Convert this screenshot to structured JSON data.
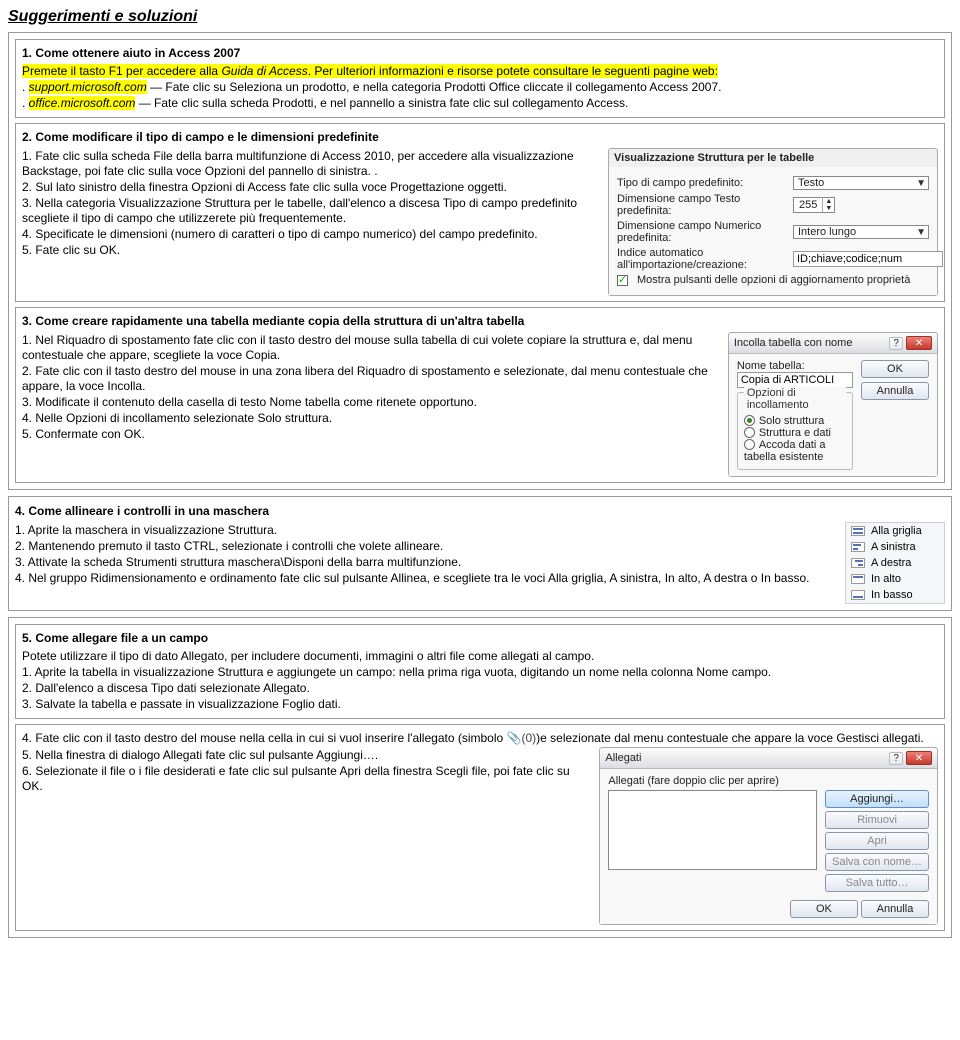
{
  "title": "Suggerimenti e soluzioni",
  "s1": {
    "head": "1. Come ottenere aiuto in Access 2007",
    "p1_a": "Premete il tasto F1 per accedere alla ",
    "p1_b": "Guida di Access",
    "p1_c": ". Per ulteriori informazioni e risorse potete consultare le seguenti pagine web:",
    "p2_a": ". ",
    "p2_b": "support.microsoft.com",
    "p2_c": " — Fate clic su Seleziona un prodotto, e nella categoria Prodotti Office cliccate il collegamento Access 2007.",
    "p3_a": ". ",
    "p3_b": "office.microsoft.com",
    "p3_c": " — Fate clic sulla scheda Prodotti, e nel pannello a sinistra fate clic sul collegamento Access."
  },
  "s2": {
    "head": "2. Come modificare il tipo di campo e le dimensioni predefinite",
    "p1": "1. Fate clic sulla scheda File della barra multifunzione di Access 2010, per accedere alla visualizzazione Backstage, poi fate clic sulla voce Opzioni del pannello di sinistra. .",
    "p2": "2. Sul lato sinistro della finestra Opzioni di Access fate clic sulla voce Progettazione oggetti.",
    "p3": "3. Nella categoria Visualizzazione Struttura per le tabelle, dall'elenco a discesa Tipo di campo predefinito scegliete il tipo di campo che utilizzerete più frequentemente.",
    "p4": "4. Specificate le dimensioni (numero di caratteri o tipo di campo numerico) del campo predefinito.",
    "p5": "5. Fate clic su OK.",
    "ui": {
      "section_title": "Visualizzazione Struttura per le tabelle",
      "f1_label": "Tipo di campo predefinito:",
      "f1_value": "Testo",
      "f2_label": "Dimensione campo Testo predefinita:",
      "f2_value": "255",
      "f3_label": "Dimensione campo Numerico predefinita:",
      "f3_value": "Intero lungo",
      "f4_label": "Indice automatico all'importazione/creazione:",
      "f4_value": "ID;chiave;codice;num",
      "chk_label": "Mostra pulsanti delle opzioni di aggiornamento proprietà"
    }
  },
  "s3": {
    "head": "3. Come creare rapidamente una tabella mediante copia della struttura di un'altra tabella",
    "p1": "1. Nel Riquadro di spostamento fate clic con il tasto destro del mouse sulla tabella di cui volete copiare la struttura e, dal menu contestuale che appare, scegliete la voce Copia.",
    "p2": "2. Fate clic con il tasto destro del mouse in una zona libera del Riquadro di spostamento e selezionate, dal menu contestuale che appare, la voce Incolla.",
    "p3": "3. Modificate il contenuto della casella di testo Nome tabella come ritenete opportuno.",
    "p4": "4. Nelle Opzioni di incollamento selezionate Solo struttura.",
    "p5": "5. Confermate con OK.",
    "dlg": {
      "title": "Incolla tabella con nome",
      "name_label": "Nome tabella:",
      "name_value": "Copia di ARTICOLI",
      "group_label": "Opzioni di incollamento",
      "r1": "Solo struttura",
      "r2": "Struttura e dati",
      "r3": "Accoda dati a tabella esistente",
      "ok": "OK",
      "cancel": "Annulla"
    }
  },
  "s4": {
    "head": "4. Come allineare i controlli in una maschera",
    "p1": "1. Aprite la maschera in visualizzazione Struttura.",
    "p2": "2. Mantenendo premuto il tasto CTRL, selezionate i controlli che volete allineare.",
    "p3": "3. Attivate la scheda Strumenti struttura maschera\\Disponi della barra multifunzione.",
    "p4": "4. Nel gruppo Ridimensionamento e ordinamento fate clic sul pulsante Allinea, e scegliete tra le voci Alla griglia, A sinistra, In alto, A destra o In basso.",
    "menu": {
      "i1": "Alla griglia",
      "i2": "A sinistra",
      "i3": "A destra",
      "i4": "In alto",
      "i5": "In basso"
    }
  },
  "s5": {
    "head": "5. Come allegare file a un campo",
    "intro": "Potete utilizzare il tipo di dato Allegato, per includere documenti, immagini o altri file come allegati al campo.",
    "p1": "1. Aprite la tabella in visualizzazione Struttura e aggiungete un campo: nella prima riga vuota, digitando un nome nella colonna Nome campo.",
    "p2": "2. Dall'elenco a discesa Tipo dati selezionate Allegato.",
    "p3": "3. Salvate la tabella e passate in visualizzazione Foglio dati."
  },
  "s6": {
    "p4a": "4. Fate clic con il tasto destro del mouse nella cella in cui si vuol inserire l'allegato (simbolo ",
    "clip": "📎(0)",
    "p4b": ")e selezionate dal menu contestuale che appare la voce Gestisci allegati.",
    "p5": "5. Nella finestra di dialogo Allegati fate clic sul pulsante Aggiungi….",
    "p6": "6. Selezionate il file o i file desiderati e fate clic sul pulsante Apri della finestra Scegli file, poi fate clic su OK.",
    "dlg": {
      "title": "Allegati",
      "label": "Allegati (fare doppio clic per aprire)",
      "b1": "Aggiungi…",
      "b2": "Rimuovi",
      "b3": "Apri",
      "b4": "Salva con nome…",
      "b5": "Salva tutto…",
      "ok": "OK",
      "cancel": "Annulla"
    }
  }
}
